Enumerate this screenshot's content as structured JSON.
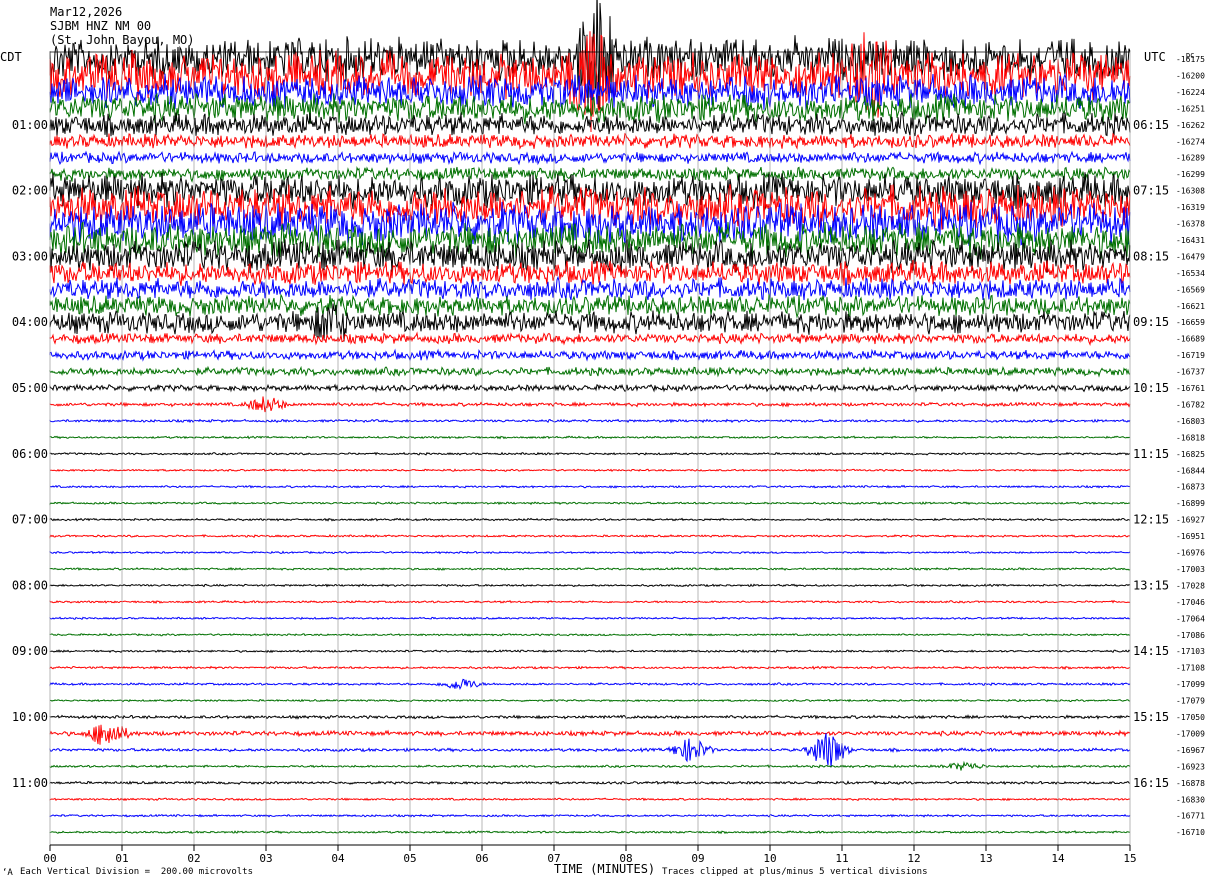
{
  "header": {
    "date": "Mar12,2026",
    "station": "SJBM HNZ NM 00",
    "location": "(St. John Bayou, MO)"
  },
  "axis": {
    "left_tz": "CDT",
    "right_tz": "UTC",
    "dc_label": "DC",
    "xlabel": "TIME (MINUTES)"
  },
  "footer": {
    "scale": "Each Vertical Division =  200.00 microvolts",
    "clip": "Traces clipped at plus/minus 5 vertical divisions",
    "mark": "‘A"
  },
  "colors": {
    "cycle": [
      "#000000",
      "#ff0000",
      "#0000ff",
      "#007000"
    ],
    "grid": "#999999"
  },
  "chart_data": {
    "type": "seismogram-helicorder",
    "minutes_per_line": 15,
    "x_ticks": [
      "00",
      "01",
      "02",
      "03",
      "04",
      "05",
      "06",
      "07",
      "08",
      "09",
      "10",
      "11",
      "12",
      "13",
      "14",
      "15"
    ],
    "left_time_labels": [
      "01:00",
      "02:00",
      "03:00",
      "04:00",
      "05:00",
      "06:00",
      "07:00",
      "08:00",
      "09:00",
      "10:00",
      "11:00"
    ],
    "right_time_labels": [
      "06:15",
      "07:15",
      "08:15",
      "09:15",
      "10:15",
      "11:15",
      "12:15",
      "13:15",
      "14:15",
      "15:15",
      "16:15"
    ],
    "dc_offsets": [
      "-16175",
      "-16200",
      "-16224",
      "-16251",
      "-16262",
      "-16274",
      "-16289",
      "-16299",
      "-16308",
      "-16319",
      "-16378",
      "-16431",
      "-16479",
      "-16534",
      "-16569",
      "-16621",
      "-16659",
      "-16689",
      "-16719",
      "-16737",
      "-16761",
      "-16782",
      "-16803",
      "-16818",
      "-16825",
      "-16844",
      "-16873",
      "-16899",
      "-16927",
      "-16951",
      "-16976",
      "-17003",
      "-17028",
      "-17046",
      "-17064",
      "-17086",
      "-17103",
      "-17108",
      "-17099",
      "-17079",
      "-17050",
      "-17009",
      "-16967",
      "-16923",
      "-16878",
      "-16830",
      "-16771",
      "-16710"
    ],
    "trace_activity": [
      4.2,
      4.5,
      3.3,
      2.8,
      2.2,
      1.4,
      1.1,
      1.3,
      3.3,
      4.0,
      4.0,
      3.4,
      3.1,
      2.3,
      2.1,
      2.0,
      2.2,
      1.0,
      0.9,
      0.8,
      0.6,
      0.35,
      0.25,
      0.2,
      0.2,
      0.18,
      0.2,
      0.2,
      0.2,
      0.2,
      0.18,
      0.2,
      0.2,
      0.2,
      0.18,
      0.18,
      0.2,
      0.22,
      0.22,
      0.18,
      0.3,
      0.45,
      0.3,
      0.22,
      0.25,
      0.2,
      0.2,
      0.2
    ],
    "events": [
      {
        "line": 0,
        "minute": 7.6,
        "amp": 14
      },
      {
        "line": 1,
        "minute": 7.5,
        "amp": 12
      },
      {
        "line": 1,
        "minute": 11.4,
        "amp": 12
      },
      {
        "line": 16,
        "minute": 3.9,
        "amp": 4
      },
      {
        "line": 21,
        "minute": 3.0,
        "amp": 2
      },
      {
        "line": 38,
        "minute": 5.7,
        "amp": 1.5
      },
      {
        "line": 41,
        "minute": 0.8,
        "amp": 3.5
      },
      {
        "line": 42,
        "minute": 8.9,
        "amp": 3
      },
      {
        "line": 42,
        "minute": 10.8,
        "amp": 5
      },
      {
        "line": 43,
        "minute": 12.7,
        "amp": 1
      }
    ]
  }
}
